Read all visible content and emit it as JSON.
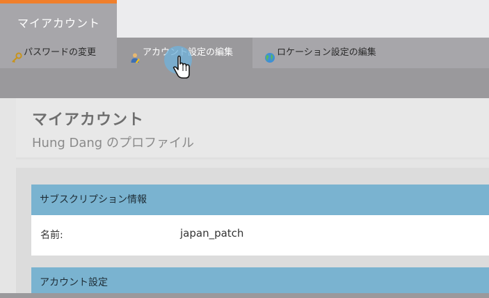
{
  "header": {
    "main_tab": "マイアカウント"
  },
  "subnav": {
    "items": [
      {
        "label": "パスワードの変更",
        "icon": "key-icon"
      },
      {
        "label": "アカウント設定の編集",
        "icon": "user-edit-icon"
      },
      {
        "label": "ロケーション設定の編集",
        "icon": "globe-icon"
      }
    ]
  },
  "profile": {
    "title": "マイアカウント",
    "subtitle": "Hung Dang のプロファイル"
  },
  "subscription": {
    "heading": "サブスクリプション情報",
    "name_label": "名前:",
    "name_value": "japan_patch"
  },
  "account_settings": {
    "heading": "アカウント設定"
  },
  "colors": {
    "accent": "#f07f2b",
    "section_header": "#7ab3d0"
  }
}
